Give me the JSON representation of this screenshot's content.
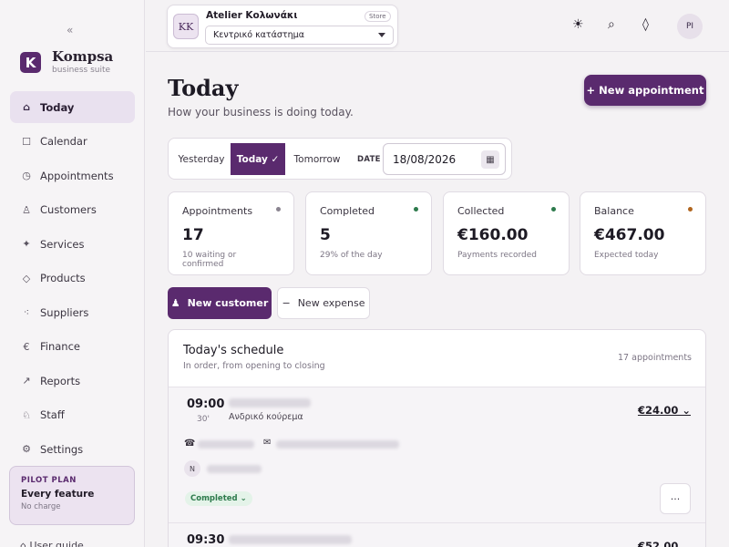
{
  "sidebar": {
    "collapse_icon": "«",
    "brand": {
      "logo_letter": "K",
      "name": "Kompsa",
      "subtitle": "business suite"
    },
    "items": [
      {
        "label": "Today",
        "icon": "home-icon",
        "glyph": "⌂",
        "active": true
      },
      {
        "label": "Calendar",
        "icon": "calendar-icon",
        "glyph": "☐"
      },
      {
        "label": "Appointments",
        "icon": "clock-icon",
        "glyph": "◷"
      },
      {
        "label": "Customers",
        "icon": "user-icon",
        "glyph": "♙"
      },
      {
        "label": "Services",
        "icon": "sparkle-icon",
        "glyph": "✦"
      },
      {
        "label": "Products",
        "icon": "diamond-icon",
        "glyph": "◇"
      },
      {
        "label": "Suppliers",
        "icon": "network-icon",
        "glyph": "⁖"
      },
      {
        "label": "Finance",
        "icon": "euro-icon",
        "glyph": "€"
      },
      {
        "label": "Reports",
        "icon": "arrow-up-right-icon",
        "glyph": "↗"
      },
      {
        "label": "Staff",
        "icon": "bell-icon",
        "glyph": "♘"
      },
      {
        "label": "Settings",
        "icon": "gear-icon",
        "glyph": "⚙"
      }
    ],
    "plan": {
      "tag": "PILOT PLAN",
      "title": "Every feature",
      "subtitle": "No charge"
    },
    "user_guide": "User guide"
  },
  "topbar": {
    "store": {
      "initials": "KK",
      "name": "Atelier Κολωνάκι",
      "tag": "Store",
      "selected": "Κεντρικό κατάστημα"
    },
    "icons": [
      "sun-icon",
      "search-icon",
      "diamond-icon"
    ],
    "avatar_initials": "PI"
  },
  "page": {
    "title": "Today",
    "subtitle": "How your business is doing today.",
    "new_appointment": "+ New appointment"
  },
  "date_bar": {
    "yesterday": "Yesterday",
    "today": "Today ✓",
    "tomorrow": "Tomorrow",
    "date_label": "DATE",
    "date_value": "18/08/2026"
  },
  "stats": [
    {
      "label": "Appointments",
      "value": "17",
      "sub": "10 waiting or confirmed",
      "dot": "#8a8490"
    },
    {
      "label": "Completed",
      "value": "5",
      "sub": "29% of the day",
      "dot": "#2d7a4c"
    },
    {
      "label": "Collected",
      "value": "€160.00",
      "sub": "Payments recorded",
      "dot": "#2d7a4c"
    },
    {
      "label": "Balance",
      "value": "€467.00",
      "sub": "Expected today",
      "dot": "#b0651e"
    }
  ],
  "actions": {
    "new_customer": "New customer",
    "new_expense": "New expense"
  },
  "schedule": {
    "title": "Today's schedule",
    "subtitle": "In order, from opening to closing",
    "count": "17 appointments",
    "appointments": [
      {
        "time": "09:00",
        "duration": "30'",
        "service": "Ανδρικό κούρεμα",
        "price": "€24.00 ⌄",
        "staff_initial": "N",
        "status": "Completed ⌄"
      },
      {
        "time": "09:30",
        "price": "€52.00 ⌄"
      }
    ]
  },
  "colors": {
    "accent": "#5a2a6e",
    "success": "#2d7a4c",
    "warning": "#b0651e"
  }
}
